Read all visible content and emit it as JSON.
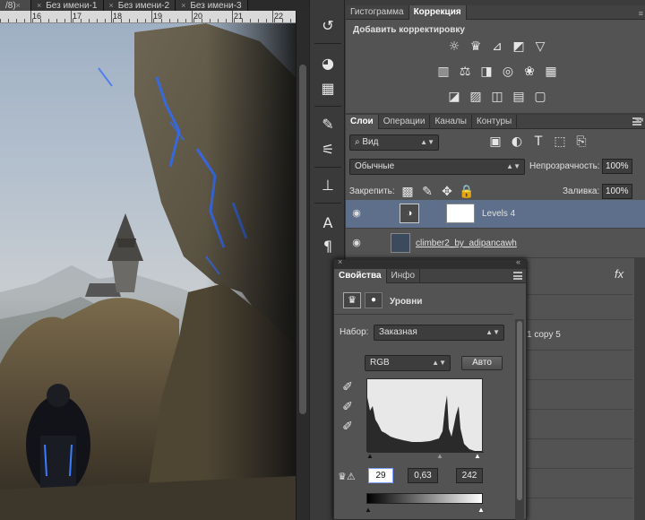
{
  "document_tabs": [
    {
      "label": "/8)",
      "close": "×"
    },
    {
      "label": "Без имени-1",
      "close": "×"
    },
    {
      "label": "Без имени-2",
      "close": "×"
    },
    {
      "label": "Без имени-3",
      "close": "×"
    }
  ],
  "ruler": {
    "ticks": [
      "16",
      "17",
      "18",
      "19",
      "20",
      "21",
      "22"
    ]
  },
  "top_panel": {
    "tabs": [
      "Гистограмма",
      "Коррекция"
    ],
    "active_tab": "Коррекция",
    "heading": "Добавить корректировку",
    "row1_icons": [
      "brightness-icon",
      "levels-icon",
      "curves-icon",
      "exposure-icon",
      "vibrance-icon"
    ],
    "row2_icons": [
      "hue-saturation-icon",
      "color-balance-icon",
      "black-white-icon",
      "photo-filter-icon",
      "channel-mixer-icon",
      "color-lookup-icon"
    ],
    "row3_icons": [
      "invert-icon",
      "posterize-icon",
      "threshold-icon",
      "gradient-map-icon",
      "selective-color-icon"
    ]
  },
  "layers_panel": {
    "tabs": [
      "Слои",
      "Операции",
      "Каналы",
      "Контуры"
    ],
    "active_tab": "Слои",
    "filter_kind": "Вид",
    "blend_mode": "Обычные",
    "opacity_label": "Непрозрачность:",
    "opacity_value": "100%",
    "lock_label": "Закрепить:",
    "fill_label": "Заливка:",
    "fill_value": "100%",
    "layers": [
      {
        "name": "Levels 4",
        "selected": true
      },
      {
        "name": "climber2_by_adipancawh",
        "selected": false
      }
    ],
    "partial_layer_text": "1 copy 5",
    "fx_label": "fx"
  },
  "properties_panel": {
    "tabs": [
      "Свойства",
      "Инфо"
    ],
    "active_tab": "Свойства",
    "title": "Уровни",
    "preset_label": "Набор:",
    "preset_value": "Заказная",
    "channel_value": "RGB",
    "auto_button": "Авто",
    "input_black": "29",
    "input_gamma": "0,63",
    "input_white": "242"
  },
  "colors": {
    "panel_bg": "#535353",
    "selected_layer": "#5d6f8a",
    "workspace": "#3c3c3c"
  }
}
